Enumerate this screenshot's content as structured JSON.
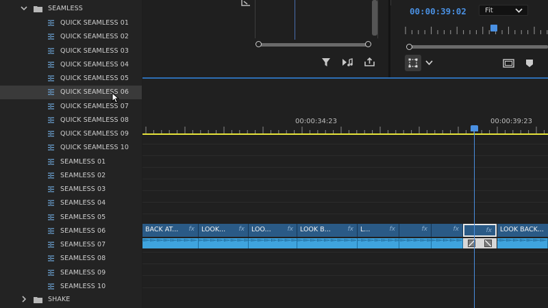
{
  "project_panel": {
    "folders": [
      {
        "label": "SEAMLESS",
        "expanded": true
      },
      {
        "label": "SHAKE",
        "expanded": false
      }
    ],
    "items": [
      "QUICK SEAMLESS 01",
      "QUICK SEAMLESS 02",
      "QUICK SEAMLESS 03",
      "QUICK SEAMLESS 04",
      "QUICK SEAMLESS 05",
      "QUICK SEAMLESS 06",
      "QUICK SEAMLESS 07",
      "QUICK SEAMLESS 08",
      "QUICK SEAMLESS 09",
      "QUICK SEAMLESS 10",
      "SEAMLESS 01",
      "SEAMLESS 02",
      "SEAMLESS 03",
      "SEAMLESS 04",
      "SEAMLESS 05",
      "SEAMLESS 06",
      "SEAMLESS 07",
      "SEAMLESS 08",
      "SEAMLESS 09",
      "SEAMLESS 10"
    ],
    "hovered_item": "QUICK SEAMLESS 06"
  },
  "program_monitor": {
    "timecode": "00:00:39:02",
    "zoom": "Fit"
  },
  "timeline": {
    "ruler_labels": [
      "00:00:34:23",
      "00:00:39:23"
    ],
    "video_clips": [
      {
        "label": "BACK AT...",
        "fx": "fx"
      },
      {
        "label": "LOOK...",
        "fx": "fx"
      },
      {
        "label": "LOO...",
        "fx": "fx"
      },
      {
        "label": "LOOK B...",
        "fx": "fx"
      },
      {
        "label": "L...",
        "fx": "fx"
      },
      {
        "label": "",
        "fx": "fx"
      },
      {
        "label": "",
        "fx": "fx"
      },
      {
        "label": "",
        "fx": "fx"
      },
      {
        "label": "LOOK BACK...",
        "fx": ""
      }
    ]
  },
  "colors": {
    "accent_blue": "#4a90e2",
    "work_area": "#e8e63a",
    "video_clip": "#2a5a86",
    "audio_clip": "#3fa4de"
  }
}
